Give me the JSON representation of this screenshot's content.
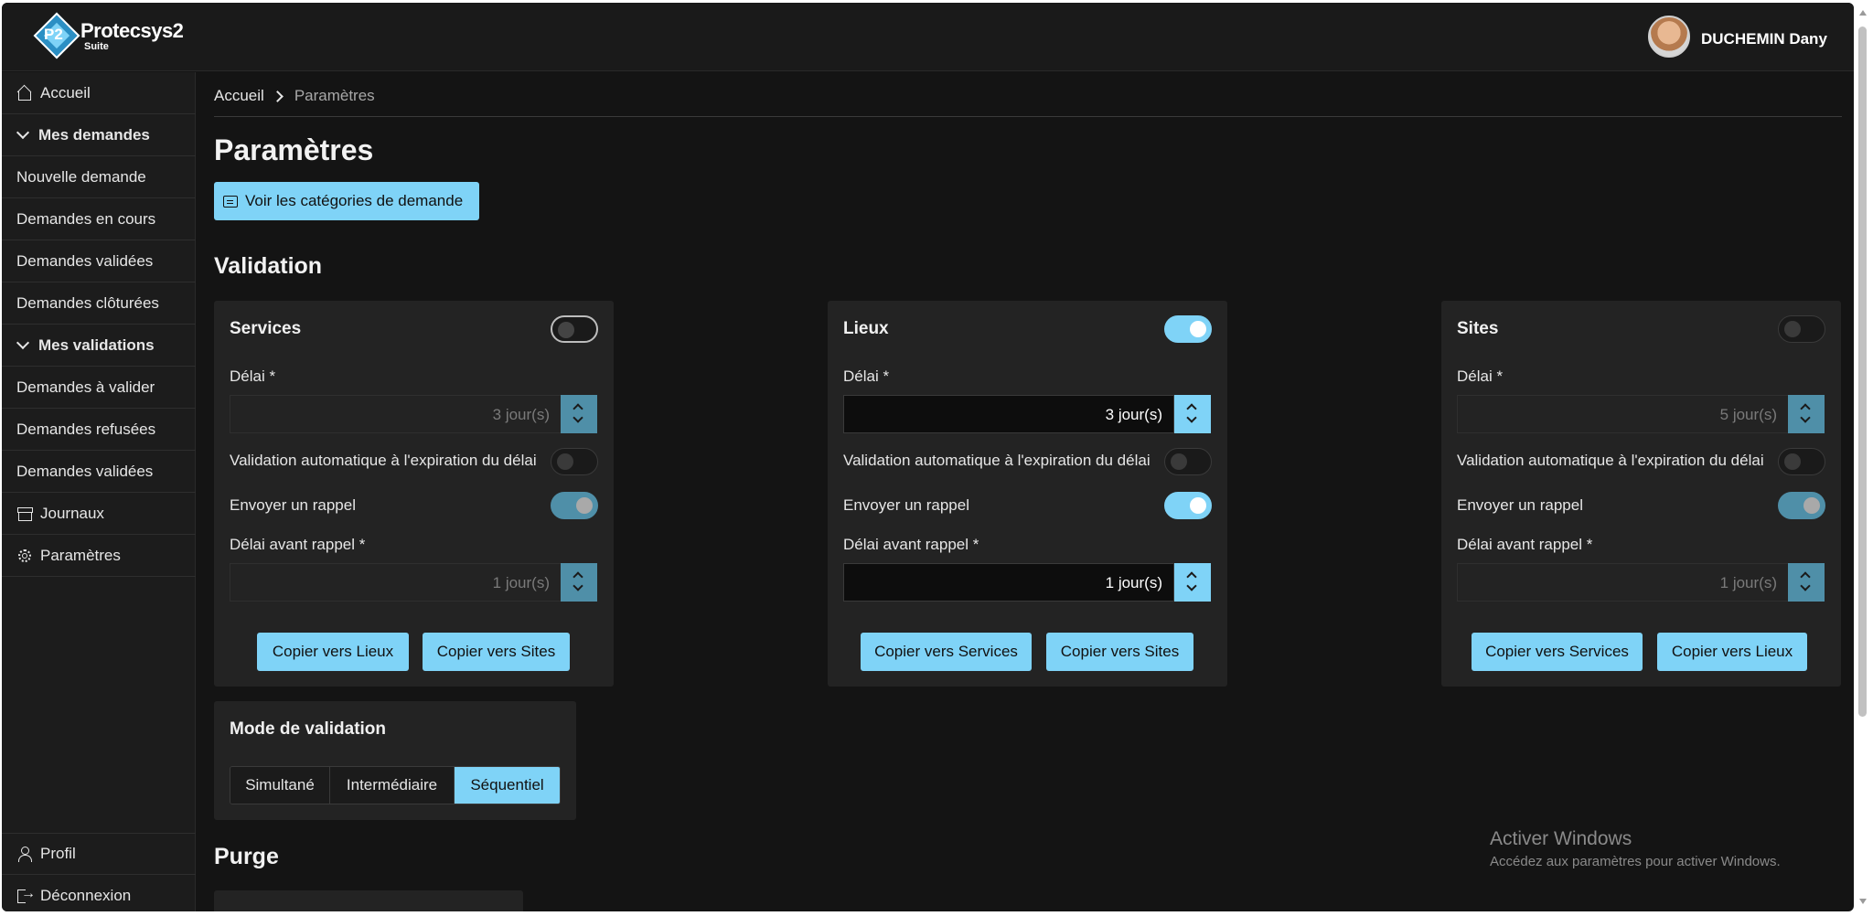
{
  "app": {
    "logo_text": "P2",
    "name": "Protecsys2",
    "subtitle": "Suite"
  },
  "user": {
    "name": "DUCHEMIN Dany"
  },
  "sidebar": {
    "home": "Accueil",
    "mes_demandes": "Mes demandes",
    "nouvelle_demande": "Nouvelle demande",
    "demandes_en_cours": "Demandes en cours",
    "demandes_validees": "Demandes validées",
    "demandes_cloturees": "Demandes clôturées",
    "mes_validations": "Mes validations",
    "demandes_a_valider": "Demandes à valider",
    "demandes_refusees": "Demandes refusées",
    "demandes_validees_2": "Demandes validées",
    "journaux": "Journaux",
    "parametres": "Paramètres",
    "profil": "Profil",
    "deconnexion": "Déconnexion"
  },
  "breadcrumb": {
    "root": "Accueil",
    "current": "Paramètres"
  },
  "page": {
    "title": "Paramètres",
    "categories_button": "Voir les catégories de demande",
    "validation_title": "Validation",
    "purge_title": "Purge"
  },
  "labels": {
    "delai": "Délai *",
    "auto_validation": "Validation automatique à l'expiration du délai",
    "rappel": "Envoyer un rappel",
    "delai_rappel": "Délai avant rappel *"
  },
  "cards": {
    "services": {
      "title": "Services",
      "enabled": false,
      "delai": "3 jour(s)",
      "rappel_delai": "1 jour(s)",
      "copy1": "Copier vers Lieux",
      "copy2": "Copier vers Sites"
    },
    "lieux": {
      "title": "Lieux",
      "enabled": true,
      "delai": "3 jour(s)",
      "rappel_delai": "1 jour(s)",
      "copy1": "Copier vers Services",
      "copy2": "Copier vers Sites"
    },
    "sites": {
      "title": "Sites",
      "enabled": false,
      "delai": "5 jour(s)",
      "rappel_delai": "1 jour(s)",
      "copy1": "Copier vers Services",
      "copy2": "Copier vers Lieux"
    }
  },
  "mode": {
    "title": "Mode de validation",
    "options": [
      "Simultané",
      "Intermédiaire",
      "Séquentiel"
    ],
    "selected": "Séquentiel"
  },
  "watermark": {
    "title": "Activer Windows",
    "subtitle": "Accédez aux paramètres pour activer Windows."
  },
  "colors": {
    "accent": "#7fd3f7",
    "background": "#141414",
    "card": "#232323"
  }
}
